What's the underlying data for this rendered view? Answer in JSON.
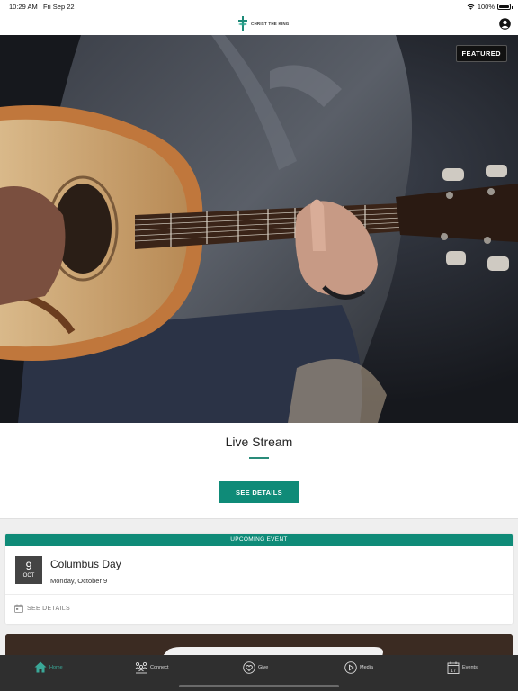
{
  "status": {
    "time": "10:29 AM",
    "date": "Fri Sep 22",
    "battery": "100%"
  },
  "header": {
    "logo_text": "CHRIST THE KING"
  },
  "featured": {
    "badge": "FEATURED",
    "title": "Live Stream",
    "button": "SEE DETAILS"
  },
  "event": {
    "header": "UPCOMING EVENT",
    "day": "9",
    "month": "OCT",
    "name": "Columbus Day",
    "date_text": "Monday, October 9",
    "footer": "SEE DETAILS"
  },
  "tabs": [
    {
      "label": "Home",
      "icon": "home-icon"
    },
    {
      "label": "Connect",
      "icon": "connect-icon"
    },
    {
      "label": "Give",
      "icon": "give-icon"
    },
    {
      "label": "Media",
      "icon": "media-icon"
    },
    {
      "label": "Events",
      "icon": "events-icon"
    }
  ],
  "colors": {
    "accent": "#0f8b78",
    "tab_active": "#3aa898",
    "tab_bar": "#2f2f2f"
  }
}
